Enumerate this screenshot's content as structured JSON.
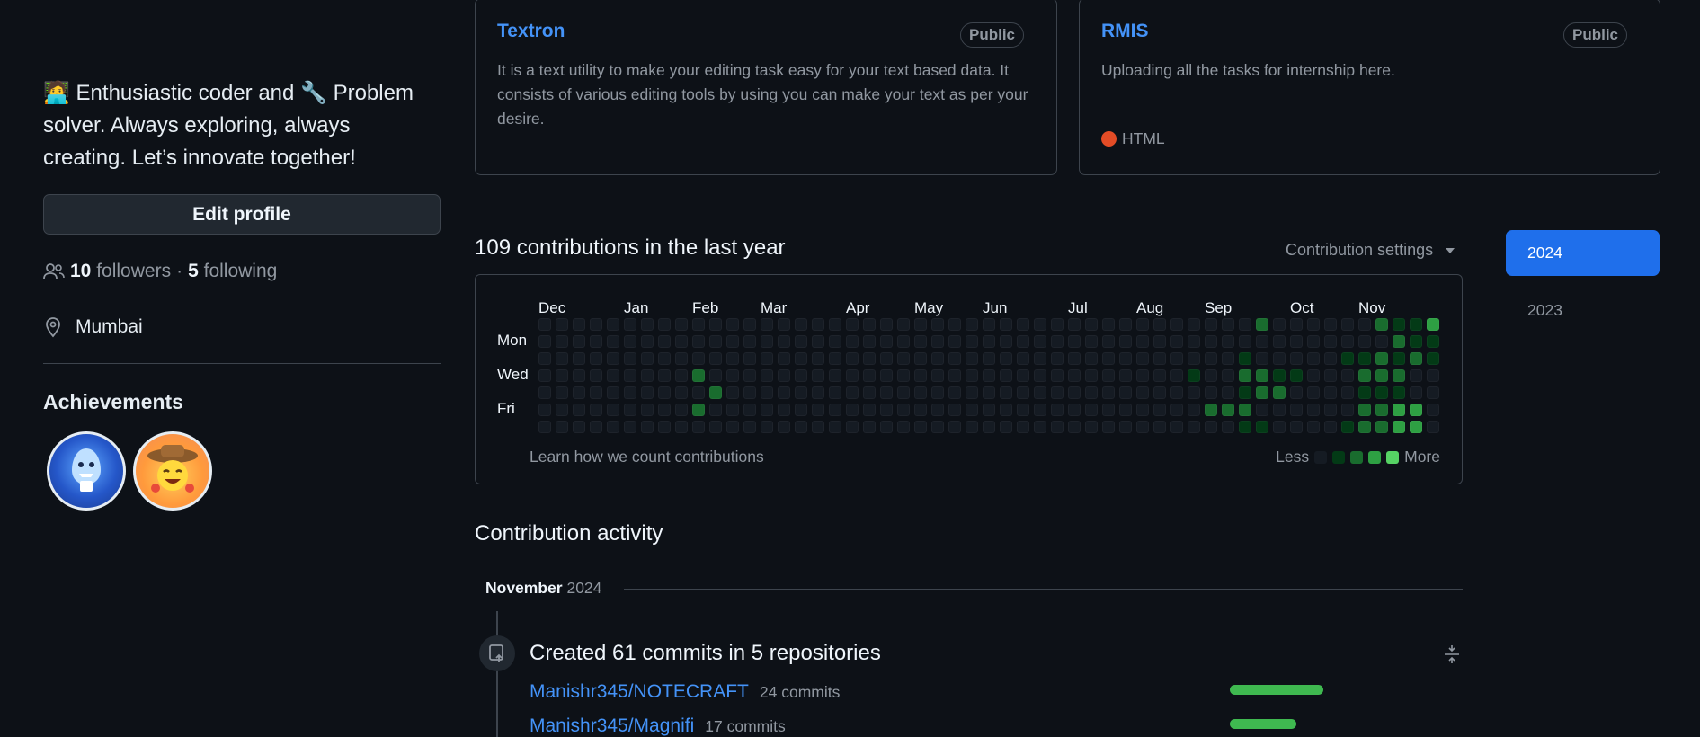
{
  "profile": {
    "bio": "🧑‍💻 Enthusiastic coder and 🔧 Problem solver. Always exploring, always creating. Let’s innovate together!",
    "edit_button": "Edit profile",
    "followers_count": "10",
    "followers_label": "followers",
    "separator": "·",
    "following_count": "5",
    "following_label": "following",
    "location": "Mumbai",
    "achievements_title": "Achievements",
    "achievements": [
      {
        "icon": "shark-achievement-icon"
      },
      {
        "icon": "cowboy-achievement-icon"
      }
    ]
  },
  "repos": [
    {
      "name": "Textron",
      "visibility": "Public",
      "description": "It is a text utility to make your editing task easy for your text based data. It consists of various editing tools by using you can make your text as per your desire."
    },
    {
      "name": "RMIS",
      "visibility": "Public",
      "description": "Uploading all the tasks for internship here.",
      "language": "HTML",
      "language_color": "#e34c26"
    }
  ],
  "contributions": {
    "title": "109 contributions in the last year",
    "settings_label": "Contribution settings",
    "months": [
      "Dec",
      "Jan",
      "Feb",
      "Mar",
      "Apr",
      "May",
      "Jun",
      "Jul",
      "Aug",
      "Sep",
      "Oct",
      "Nov"
    ],
    "day_labels": [
      "Mon",
      "Wed",
      "Fri"
    ],
    "learn_link": "Learn how we count contributions",
    "legend_less": "Less",
    "legend_more": "More",
    "colors": [
      "#151b23",
      "#033a16",
      "#196c2e",
      "#2ea043",
      "#56d364"
    ],
    "weeks": 53,
    "active_cells": [
      [
        9,
        3,
        2
      ],
      [
        9,
        5,
        2
      ],
      [
        10,
        4,
        2
      ],
      [
        38,
        3,
        1
      ],
      [
        39,
        5,
        2
      ],
      [
        40,
        5,
        2
      ],
      [
        41,
        2,
        1
      ],
      [
        41,
        3,
        2
      ],
      [
        41,
        4,
        1
      ],
      [
        41,
        5,
        2
      ],
      [
        41,
        6,
        1
      ],
      [
        42,
        0,
        2
      ],
      [
        42,
        3,
        2
      ],
      [
        42,
        4,
        2
      ],
      [
        42,
        6,
        1
      ],
      [
        43,
        3,
        1
      ],
      [
        43,
        4,
        2
      ],
      [
        44,
        3,
        1
      ],
      [
        47,
        2,
        1
      ],
      [
        47,
        6,
        1
      ],
      [
        48,
        2,
        1
      ],
      [
        48,
        3,
        2
      ],
      [
        48,
        4,
        1
      ],
      [
        48,
        5,
        2
      ],
      [
        48,
        6,
        2
      ],
      [
        49,
        0,
        2
      ],
      [
        49,
        2,
        2
      ],
      [
        49,
        3,
        2
      ],
      [
        49,
        4,
        1
      ],
      [
        49,
        5,
        2
      ],
      [
        49,
        6,
        2
      ],
      [
        50,
        0,
        1
      ],
      [
        50,
        1,
        2
      ],
      [
        50,
        2,
        1
      ],
      [
        50,
        3,
        2
      ],
      [
        50,
        4,
        1
      ],
      [
        50,
        5,
        3
      ],
      [
        50,
        6,
        3
      ],
      [
        51,
        0,
        1
      ],
      [
        51,
        1,
        1
      ],
      [
        51,
        2,
        2
      ],
      [
        51,
        5,
        3
      ],
      [
        51,
        6,
        3
      ],
      [
        52,
        0,
        3
      ],
      [
        52,
        1,
        1
      ],
      [
        52,
        2,
        1
      ]
    ]
  },
  "years": [
    "2024",
    "2023"
  ],
  "activity": {
    "title": "Contribution activity",
    "month": "November",
    "year": "2024",
    "commits_summary": "Created 61 commits in 5 repositories",
    "repos": [
      {
        "name": "Manishr345/NOTECRAFT",
        "commits": "24 commits",
        "value": 24
      },
      {
        "name": "Manishr345/Magnifi",
        "commits": "17 commits",
        "value": 17
      }
    ]
  }
}
